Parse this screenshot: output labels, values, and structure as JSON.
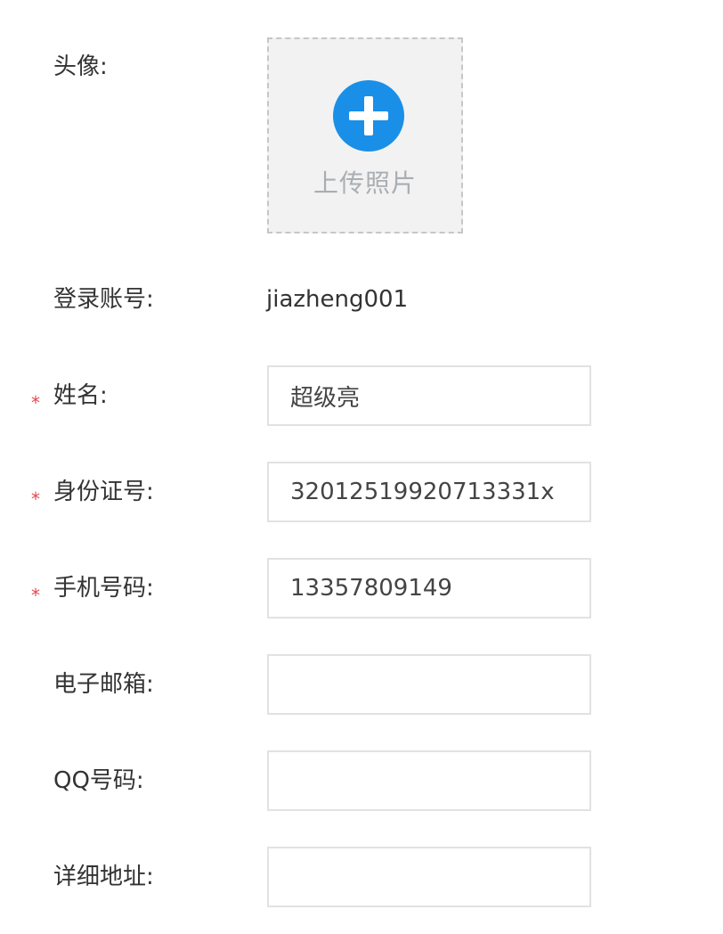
{
  "form": {
    "avatar": {
      "label": "头像:",
      "upload_text": "上传照片"
    },
    "login_account": {
      "label": "登录账号:",
      "value": "jiazheng001"
    },
    "name": {
      "required_mark": "*",
      "label": "姓名:",
      "value": "超级亮"
    },
    "id_number": {
      "required_mark": "*",
      "label": "身份证号:",
      "value": "32012519920713331x"
    },
    "phone": {
      "required_mark": "*",
      "label": "手机号码:",
      "value": "13357809149"
    },
    "email": {
      "label": "电子邮箱:",
      "value": ""
    },
    "qq": {
      "label": "QQ号码:",
      "value": ""
    },
    "address": {
      "label": "详细地址:",
      "value": ""
    }
  },
  "colors": {
    "required_star": "#e5484d",
    "upload_icon": "#1a8fe8",
    "upload_background": "#f2f2f2",
    "upload_text": "#a9aeb3",
    "input_border": "#e2e2e2"
  },
  "icons": {
    "upload": "plus-circle-icon"
  }
}
